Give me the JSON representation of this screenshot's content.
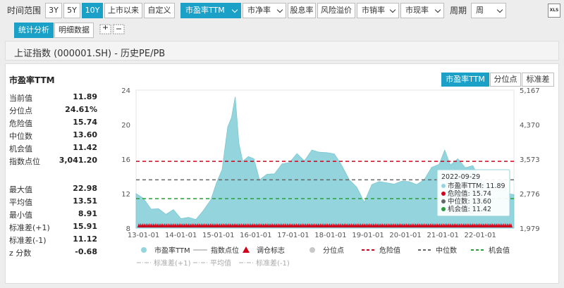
{
  "toolbar": {
    "time_range_label": "时间范围",
    "range_buttons": [
      "3Y",
      "5Y",
      "10Y",
      "上市以来",
      "自定义"
    ],
    "range_active": "10Y",
    "metric_dropdowns": [
      "市盈率TTM",
      "市净率"
    ],
    "plain_buttons": [
      "股息率",
      "风险溢价"
    ],
    "more_dropdowns": [
      "市销率",
      "市现率"
    ],
    "period_label": "周期",
    "period_value": "周",
    "export_label": "XLS"
  },
  "view_tabs": [
    "统计分析",
    "明细数据"
  ],
  "zoom_icons": [
    "zoom-in-icon",
    "zoom-out-icon"
  ],
  "panel": {
    "title": "上证指数 (000001.SH) - 历史PE/PB"
  },
  "chart_header": {
    "title": "市盈率TTM",
    "mode_buttons": [
      "市盈率TTM",
      "分位点",
      "标准差"
    ]
  },
  "stats": [
    {
      "k": "当前值",
      "v": "11.89"
    },
    {
      "k": "分位点",
      "v": "24.61%"
    },
    {
      "k": "危险值",
      "v": "15.74"
    },
    {
      "k": "中位数",
      "v": "13.60"
    },
    {
      "k": "机会值",
      "v": "11.42"
    },
    {
      "k": "指数点位",
      "v": "3,041.20"
    }
  ],
  "stats2": [
    {
      "k": "最大值",
      "v": "22.98"
    },
    {
      "k": "平均值",
      "v": "13.51"
    },
    {
      "k": "最小值",
      "v": "8.91"
    },
    {
      "k": "标准差(+1)",
      "v": "15.91"
    },
    {
      "k": "标准差(-1)",
      "v": "11.12"
    },
    {
      "k": "z 分数",
      "v": "-0.68"
    }
  ],
  "tooltip": {
    "date": "2022-09-29",
    "rows": [
      {
        "label": "市盈率TTM: 11.89",
        "color": "#94d5dd"
      },
      {
        "label": "危险值: 15.74",
        "color": "#d0021b"
      },
      {
        "label": "中位数: 13.60",
        "color": "#666666"
      },
      {
        "label": "机会值: 11.42",
        "color": "#2a9d3b"
      }
    ]
  },
  "legend": {
    "row1": [
      {
        "label": "市盈率TTM",
        "kind": "dot",
        "color": "#94d5dd"
      },
      {
        "label": "指数点位",
        "kind": "line",
        "color": "#c8c8c8"
      },
      {
        "label": "调仓标志",
        "kind": "triangle",
        "color": "#d0021b"
      },
      {
        "label": "分位点",
        "kind": "dot",
        "color": "#c8c8c8"
      },
      {
        "label": "危险值",
        "kind": "dash",
        "color": "#d0021b"
      },
      {
        "label": "中位数",
        "kind": "dash",
        "color": "#666666"
      },
      {
        "label": "机会值",
        "kind": "dash",
        "color": "#2a9d3b"
      }
    ],
    "row2": [
      {
        "label": "标准差(+1)",
        "kind": "dashdot",
        "color": "#c8c8c8"
      },
      {
        "label": "平均值",
        "kind": "dashdot",
        "color": "#c8c8c8"
      },
      {
        "label": "标准差(-1)",
        "kind": "dashdot",
        "color": "#c8c8c8"
      }
    ]
  },
  "chart_data": {
    "type": "area",
    "title": "",
    "x_ticks": [
      "13-01-01",
      "14-01-01",
      "15-01-01",
      "16-01-01",
      "17-01-01",
      "18-01-01",
      "19-01-01",
      "20-01-01",
      "21-01-01",
      "22-01-01"
    ],
    "x_range": [
      2012.8,
      2022.9
    ],
    "ylim": [
      8,
      24
    ],
    "y_ticks": [
      "8",
      "12",
      "16",
      "20",
      "24"
    ],
    "y2_ticks": [
      "1,979",
      "2,776",
      "3,573",
      "4,370",
      "5,167"
    ],
    "reference_lines": {
      "danger": 15.74,
      "median": 13.6,
      "opportunity": 11.42
    },
    "series": [
      {
        "name": "市盈率TTM",
        "x": [
          2012.8,
          2013.0,
          2013.2,
          2013.4,
          2013.6,
          2013.8,
          2014.0,
          2014.2,
          2014.4,
          2014.6,
          2014.8,
          2014.95,
          2015.1,
          2015.25,
          2015.35,
          2015.45,
          2015.55,
          2015.65,
          2015.8,
          2015.95,
          2016.1,
          2016.3,
          2016.5,
          2016.7,
          2016.9,
          2017.1,
          2017.3,
          2017.5,
          2017.7,
          2017.9,
          2018.1,
          2018.3,
          2018.5,
          2018.7,
          2018.9,
          2019.1,
          2019.3,
          2019.5,
          2019.7,
          2019.9,
          2020.1,
          2020.3,
          2020.5,
          2020.7,
          2020.9,
          2021.05,
          2021.2,
          2021.4,
          2021.6,
          2021.8,
          2022.0,
          2022.2,
          2022.4,
          2022.6,
          2022.75,
          2022.9
        ],
        "values": [
          12.0,
          11.2,
          10.4,
          10.0,
          9.8,
          9.9,
          9.3,
          9.0,
          9.2,
          9.8,
          11.5,
          13.0,
          15.0,
          19.5,
          21.0,
          22.98,
          18.0,
          15.5,
          16.5,
          15.8,
          13.8,
          14.0,
          14.5,
          15.2,
          15.8,
          16.4,
          16.0,
          16.8,
          17.0,
          16.5,
          16.8,
          15.0,
          13.8,
          12.5,
          11.2,
          12.8,
          13.6,
          13.0,
          13.3,
          13.2,
          13.6,
          12.8,
          13.8,
          14.8,
          15.6,
          16.8,
          15.5,
          15.8,
          15.2,
          15.0,
          13.8,
          12.8,
          13.6,
          13.2,
          12.2,
          11.89
        ]
      },
      {
        "name": "调仓标志",
        "values": [
          8.4
        ]
      }
    ]
  }
}
